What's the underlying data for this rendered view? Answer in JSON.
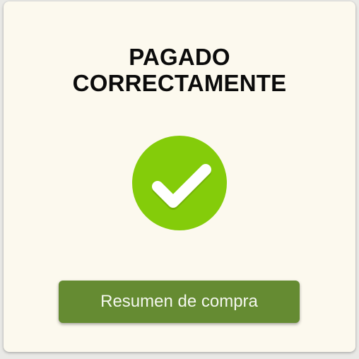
{
  "title": {
    "line1": "PAGADO",
    "line2": "CORRECTAMENTE"
  },
  "status_icon": {
    "name": "checkmark-circle-icon",
    "color": "#84cc0a",
    "check_color": "#ffffff"
  },
  "summary_button": {
    "label": "Resumen de compra",
    "color": "#658b32"
  }
}
